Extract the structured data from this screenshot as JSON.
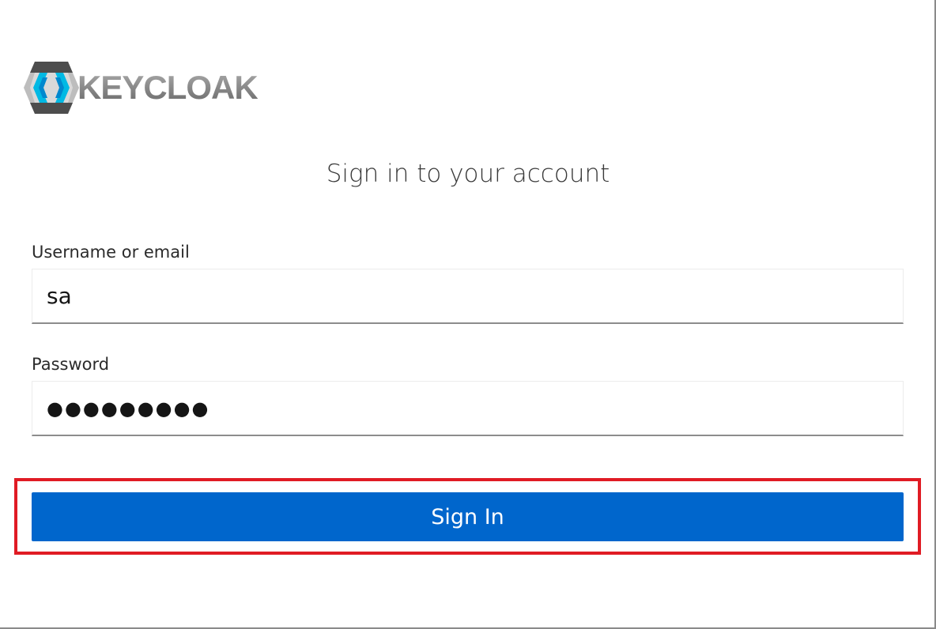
{
  "brand": {
    "name": "KEYCLOAK",
    "logo_icon": "keycloak-hexagon-icon",
    "colors": {
      "mark_dark": "#4d4d4d",
      "mark_light": "#bdbdbd",
      "mark_accent": "#00b9e4",
      "mark_accent_dark": "#0088ce"
    }
  },
  "form": {
    "title": "Sign in to your account",
    "username": {
      "label": "Username or email",
      "value": "sa"
    },
    "password": {
      "label": "Password",
      "value": "●●●●●●●●●"
    },
    "submit_label": "Sign In"
  },
  "colors": {
    "primary_button": "#0066cc",
    "highlight_border": "#e01b24",
    "input_underline": "#8c8c8c"
  }
}
